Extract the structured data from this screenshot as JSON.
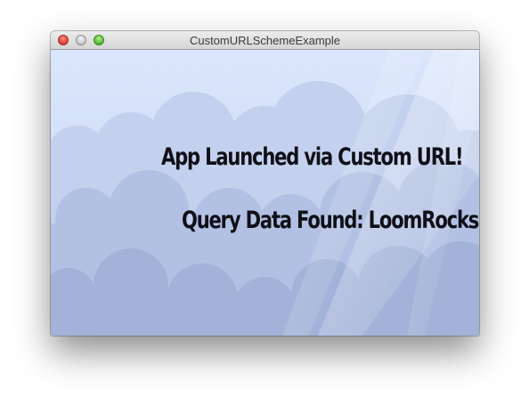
{
  "window": {
    "title": "CustomURLSchemeExample"
  },
  "controls": {
    "close_icon": "close-icon",
    "minimize_icon": "minimize-icon",
    "zoom_icon": "zoom-icon"
  },
  "content": {
    "headline": "App Launched via Custom URL!",
    "query_line": "Query Data Found: LoomRocks"
  },
  "colors": {
    "sky_top": "#d9e5fb",
    "cloud_light": "#b9c7e6",
    "cloud_mid": "#a9b8dc",
    "cloud_dark": "#98a8cf",
    "text": "#101018"
  }
}
